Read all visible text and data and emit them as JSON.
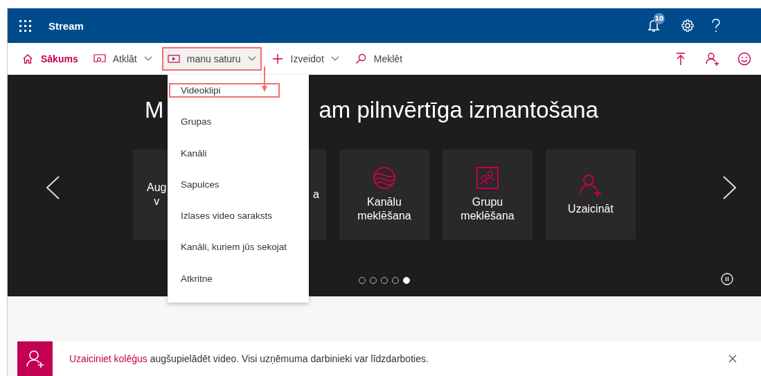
{
  "topbar": {
    "app_title": "Stream",
    "notification_count": "10"
  },
  "nav": [
    {
      "label": "Sākums",
      "kind": "home",
      "dropdown": false,
      "selected": true,
      "highlighted": false
    },
    {
      "label": "Atklāt",
      "kind": "discover",
      "dropdown": true,
      "selected": false,
      "highlighted": false
    },
    {
      "label": "manu saturu",
      "kind": "video",
      "dropdown": true,
      "selected": false,
      "highlighted": true
    },
    {
      "label": "Izveidot",
      "kind": "create",
      "dropdown": true,
      "selected": false,
      "highlighted": false
    },
    {
      "label": "Meklēt",
      "kind": "search",
      "dropdown": false,
      "selected": false,
      "highlighted": false
    }
  ],
  "hero": {
    "title_start": "M",
    "title_end": "am pilnvērtīga izmantošana",
    "tiles": [
      {
        "kind": "partial",
        "lines": [
          "Aug",
          "v"
        ]
      },
      {
        "kind": "partial",
        "lines": [
          "a"
        ]
      },
      {
        "kind": "channels",
        "lines": [
          "Kanālu",
          "meklēšana"
        ]
      },
      {
        "kind": "groups",
        "lines": [
          "Grupu",
          "meklēšana"
        ]
      },
      {
        "kind": "invite",
        "lines": [
          "Uzaicināt"
        ]
      }
    ],
    "dots": [
      {
        "selected": false
      },
      {
        "selected": false
      },
      {
        "selected": false
      },
      {
        "selected": false
      },
      {
        "selected": true
      }
    ]
  },
  "menu": [
    {
      "label": "Videoklipi",
      "highlighted": true
    },
    {
      "label": "Grupas",
      "highlighted": false
    },
    {
      "label": "Kanāli",
      "highlighted": false
    },
    {
      "label": "Sapulces",
      "highlighted": false
    },
    {
      "label": "Izlases video saraksts",
      "highlighted": false
    },
    {
      "label": "Kanāli, kuriem jūs sekojat",
      "highlighted": false
    },
    {
      "label": "Atkritne",
      "highlighted": false
    }
  ],
  "banner": {
    "link": "Uzaiciniet kolēģus",
    "text": "augšupielādēt video. Visi uzņēmuma darbinieki var līdzdarboties."
  }
}
